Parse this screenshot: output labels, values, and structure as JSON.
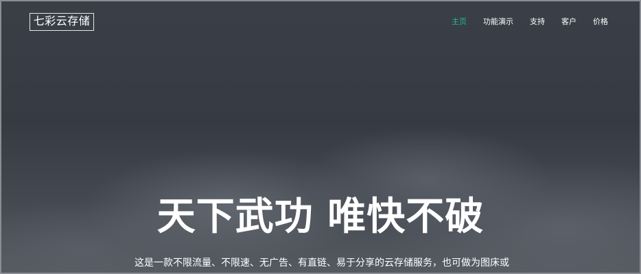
{
  "brand": {
    "logo_text": "七彩云存储"
  },
  "nav": {
    "items": [
      {
        "label": "主页",
        "active": true
      },
      {
        "label": "功能演示",
        "active": false
      },
      {
        "label": "支持",
        "active": false
      },
      {
        "label": "客户",
        "active": false
      },
      {
        "label": "价格",
        "active": false
      }
    ]
  },
  "hero": {
    "title": "天下武功 唯快不破",
    "subtitle": "这是一款不限流量、不限速、无广告、有直链、易于分享的云存储服务，也可做为图床或者视"
  },
  "colors": {
    "accent": "#1abc9c",
    "text": "#ffffff",
    "background": "#363b43"
  }
}
